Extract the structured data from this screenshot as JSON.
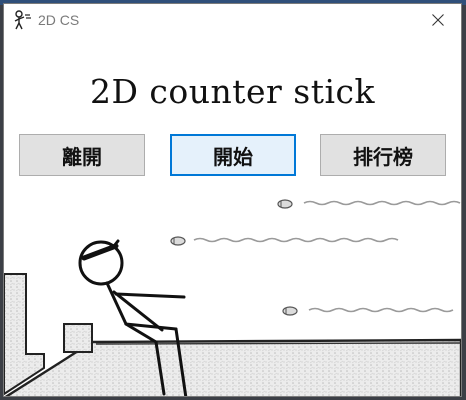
{
  "window": {
    "title": "2D CS",
    "app_icon": "stick-figure-icon",
    "close_icon": "close-icon"
  },
  "main": {
    "heading": "2D counter stick"
  },
  "menu": {
    "exit_label": "離開",
    "start_label": "開始",
    "leaderboard_label": "排行榜"
  },
  "scene": {
    "description_icon": "stick-figure-dodging-bullets-illustration"
  },
  "colors": {
    "focus_border": "#0078d7",
    "button_face": "#e1e1e1",
    "title_text": "#111111"
  }
}
